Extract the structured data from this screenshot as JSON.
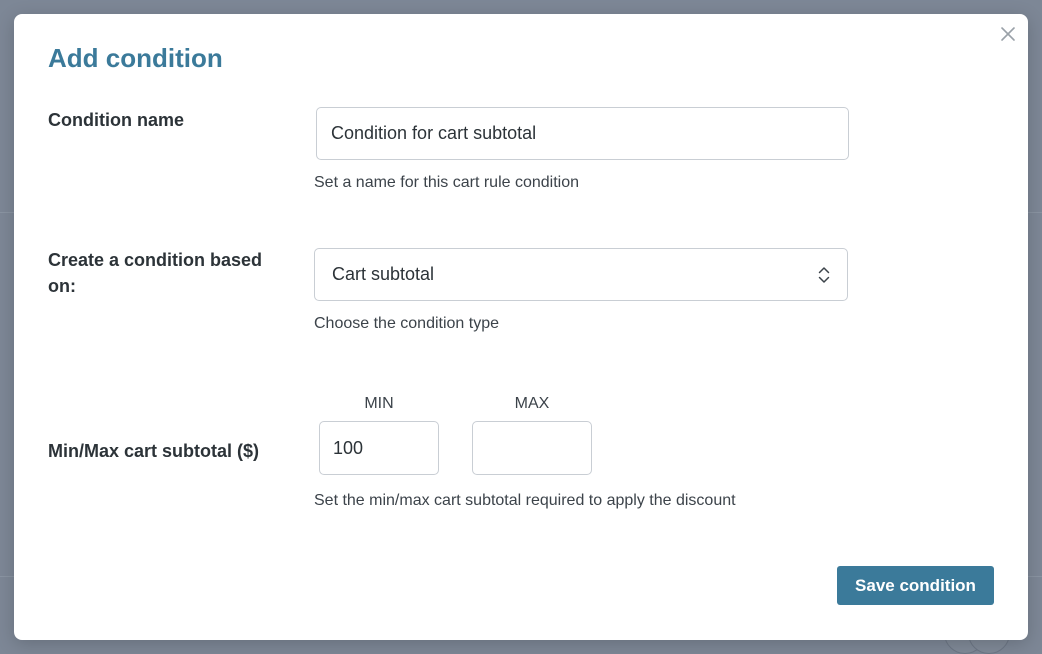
{
  "modal": {
    "title": "Add condition",
    "close_icon": "close-icon",
    "fields": {
      "name": {
        "label": "Condition name",
        "value": "Condition for cart subtotal",
        "help": "Set a name for this cart rule condition"
      },
      "type": {
        "label": "Create a condition based on:",
        "selected": "Cart subtotal",
        "chevron_icon": "select-chevrons-icon",
        "help": "Choose the condition type"
      },
      "range": {
        "label": "Min/Max cart subtotal ($)",
        "min_label": "MIN",
        "max_label": "MAX",
        "min_value": "100",
        "max_value": "",
        "help": "Set the min/max cart subtotal required to apply the discount"
      }
    },
    "save_label": "Save condition"
  },
  "colors": {
    "accent": "#3b7a9a",
    "overlay": "#7b8594",
    "input_border": "#c9ced4"
  }
}
